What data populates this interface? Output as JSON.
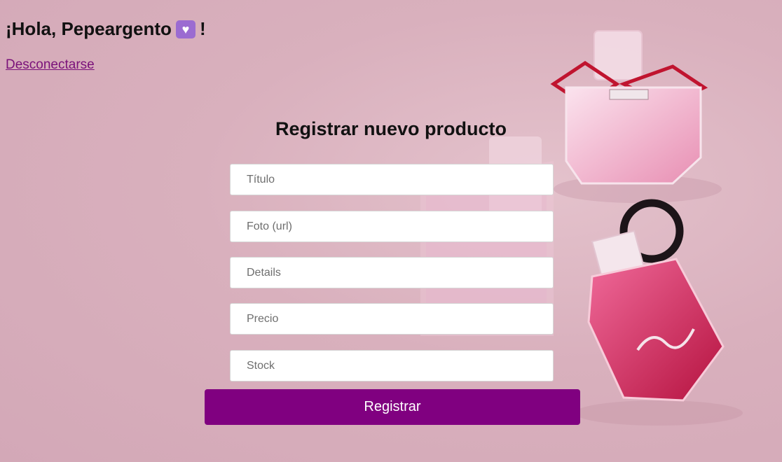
{
  "header": {
    "greeting": "¡Hola, Pepeargento",
    "greeting_end": "!",
    "badge_icon": "heart-icon",
    "logout_label": "Desconectarse"
  },
  "form": {
    "title": "Registrar nuevo producto",
    "fields": {
      "titulo": "Título",
      "foto": "Foto (url)",
      "details": "Details",
      "precio": "Precio",
      "stock": "Stock"
    },
    "submit_label": "Registrar"
  },
  "colors": {
    "accent": "#800080",
    "link": "#7a117a",
    "badge": "#9b6bd1",
    "background": "#d9b0bd"
  }
}
